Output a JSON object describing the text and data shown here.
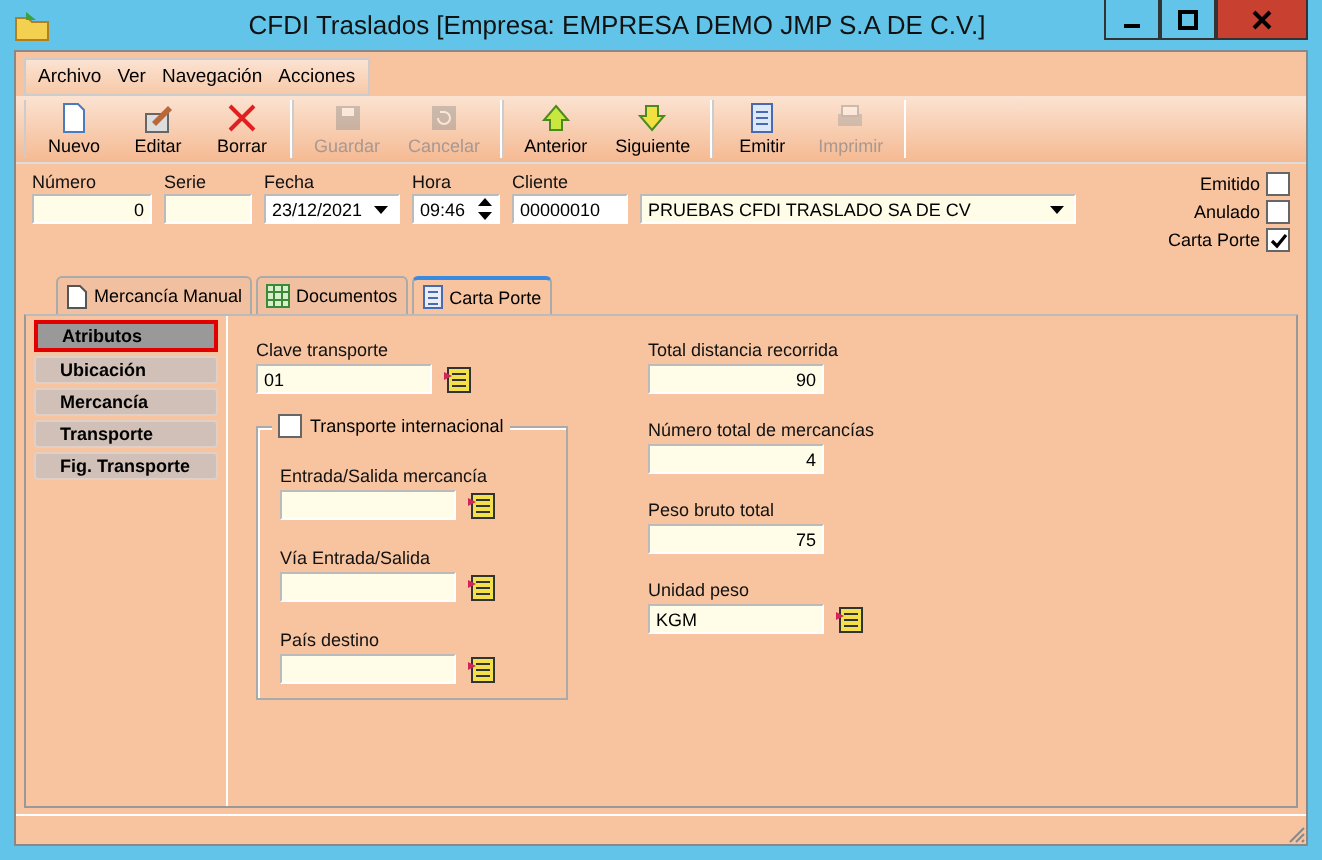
{
  "window": {
    "title": "CFDI Traslados [Empresa: EMPRESA DEMO JMP S.A DE C.V.]"
  },
  "menu": [
    "Archivo",
    "Ver",
    "Navegación",
    "Acciones"
  ],
  "toolbar": [
    [
      {
        "kind": "new",
        "label": "Nuevo",
        "disabled": false
      },
      {
        "kind": "edit",
        "label": "Editar",
        "disabled": false
      },
      {
        "kind": "delete",
        "label": "Borrar",
        "disabled": false
      }
    ],
    [
      {
        "kind": "save",
        "label": "Guardar",
        "disabled": true
      },
      {
        "kind": "cancel",
        "label": "Cancelar",
        "disabled": true
      }
    ],
    [
      {
        "kind": "up",
        "label": "Anterior",
        "disabled": false
      },
      {
        "kind": "down",
        "label": "Siguiente",
        "disabled": false
      }
    ],
    [
      {
        "kind": "doc",
        "label": "Emitir",
        "disabled": false
      },
      {
        "kind": "print",
        "label": "Imprimir",
        "disabled": true
      }
    ]
  ],
  "header": {
    "numero": {
      "label": "Número",
      "value": "0"
    },
    "serie": {
      "label": "Serie"
    },
    "fecha": {
      "label": "Fecha",
      "value": "23/12/2021"
    },
    "hora": {
      "label": "Hora",
      "value": "09:46"
    },
    "cliente": {
      "label": "Cliente",
      "code": "00000010",
      "name": "PRUEBAS CFDI TRASLADO SA DE CV"
    }
  },
  "flags": [
    {
      "label": "Emitido",
      "checked": false
    },
    {
      "label": "Anulado",
      "checked": false
    },
    {
      "label": "Carta Porte",
      "checked": true
    }
  ],
  "tabs": [
    {
      "label": "Mercancía Manual",
      "kind": "page",
      "selected": false
    },
    {
      "label": "Documentos",
      "kind": "grid",
      "selected": false
    },
    {
      "label": "Carta Porte",
      "kind": "form",
      "selected": true
    }
  ],
  "sidebar": [
    {
      "label": "Atributos",
      "selected": true
    },
    {
      "label": "Ubicación",
      "selected": false
    },
    {
      "label": "Mercancía",
      "selected": false
    },
    {
      "label": "Transporte",
      "selected": false
    },
    {
      "label": "Fig. Transporte",
      "selected": false
    }
  ],
  "clave_transporte": {
    "label": "Clave transporte",
    "value": "01"
  },
  "transporte_internacional": {
    "label": "Transporte internacional",
    "checked": false,
    "fields": [
      {
        "label": "Entrada/Salida mercancía"
      },
      {
        "label": "Vía Entrada/Salida"
      },
      {
        "label": "País destino"
      }
    ]
  },
  "totals": [
    {
      "label": "Total distancia recorrida",
      "value": "90",
      "kind": "number"
    },
    {
      "label": "Número total de mercancías",
      "value": "4",
      "kind": "number"
    },
    {
      "label": "Peso bruto total",
      "value": "75",
      "kind": "number"
    },
    {
      "label": "Unidad peso",
      "value": "KGM",
      "kind": "lookup"
    }
  ]
}
